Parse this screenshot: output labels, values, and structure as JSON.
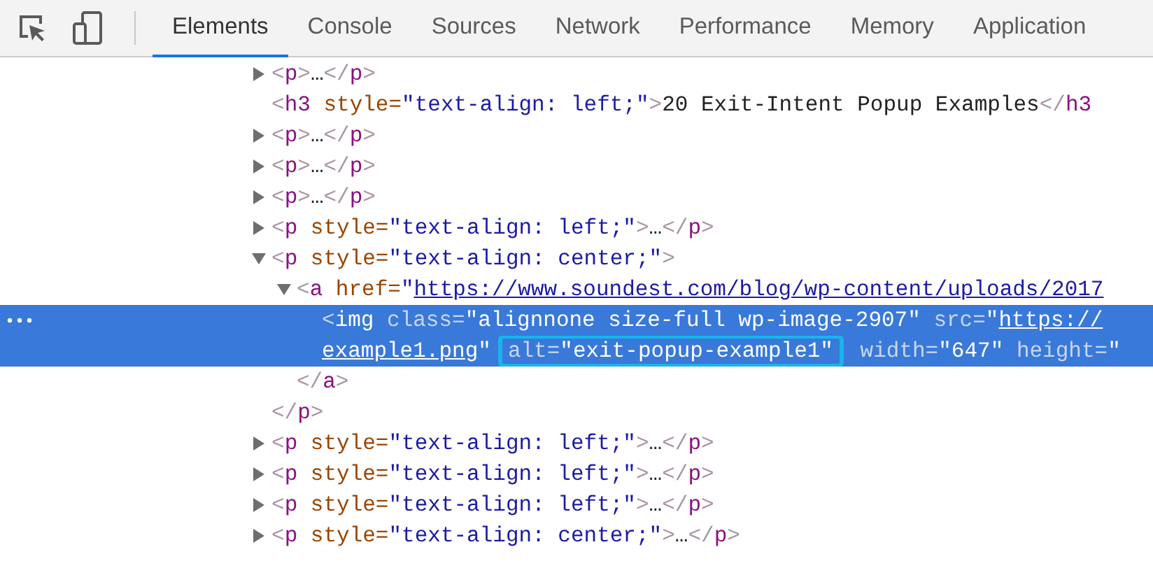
{
  "toolbar": {
    "tabs": [
      {
        "label": "Elements",
        "selected": true
      },
      {
        "label": "Console",
        "selected": false
      },
      {
        "label": "Sources",
        "selected": false
      },
      {
        "label": "Network",
        "selected": false
      },
      {
        "label": "Performance",
        "selected": false
      },
      {
        "label": "Memory",
        "selected": false
      },
      {
        "label": "Application",
        "selected": false
      }
    ]
  },
  "dom_tree": [
    {
      "expanded": false,
      "selected": false,
      "tokens": [
        {
          "kind": "punct",
          "text": "<"
        },
        {
          "kind": "tag",
          "text": "p"
        },
        {
          "kind": "punct",
          "text": ">"
        },
        {
          "kind": "text",
          "text": "…"
        },
        {
          "kind": "punct",
          "text": "</"
        },
        {
          "kind": "tag",
          "text": "p"
        },
        {
          "kind": "punct",
          "text": ">"
        }
      ]
    },
    {
      "selected": false,
      "tokens": [
        {
          "kind": "punct",
          "text": "<"
        },
        {
          "kind": "tag",
          "text": "h3"
        },
        {
          "kind": "attr",
          "text": " style="
        },
        {
          "kind": "value",
          "text": "\"text-align: left;\""
        },
        {
          "kind": "punct",
          "text": ">"
        },
        {
          "kind": "text",
          "text": "20 Exit-Intent Popup Examples"
        },
        {
          "kind": "punct",
          "text": "</"
        },
        {
          "kind": "tag",
          "text": "h3"
        }
      ]
    },
    {
      "expanded": false,
      "selected": false,
      "tokens": [
        {
          "kind": "punct",
          "text": "<"
        },
        {
          "kind": "tag",
          "text": "p"
        },
        {
          "kind": "punct",
          "text": ">"
        },
        {
          "kind": "text",
          "text": "…"
        },
        {
          "kind": "punct",
          "text": "</"
        },
        {
          "kind": "tag",
          "text": "p"
        },
        {
          "kind": "punct",
          "text": ">"
        }
      ]
    },
    {
      "expanded": false,
      "selected": false,
      "tokens": [
        {
          "kind": "punct",
          "text": "<"
        },
        {
          "kind": "tag",
          "text": "p"
        },
        {
          "kind": "punct",
          "text": ">"
        },
        {
          "kind": "text",
          "text": "…"
        },
        {
          "kind": "punct",
          "text": "</"
        },
        {
          "kind": "tag",
          "text": "p"
        },
        {
          "kind": "punct",
          "text": ">"
        }
      ]
    },
    {
      "expanded": false,
      "selected": false,
      "tokens": [
        {
          "kind": "punct",
          "text": "<"
        },
        {
          "kind": "tag",
          "text": "p"
        },
        {
          "kind": "punct",
          "text": ">"
        },
        {
          "kind": "text",
          "text": "…"
        },
        {
          "kind": "punct",
          "text": "</"
        },
        {
          "kind": "tag",
          "text": "p"
        },
        {
          "kind": "punct",
          "text": ">"
        }
      ]
    },
    {
      "expanded": false,
      "selected": false,
      "tokens": [
        {
          "kind": "punct",
          "text": "<"
        },
        {
          "kind": "tag",
          "text": "p"
        },
        {
          "kind": "attr",
          "text": " style="
        },
        {
          "kind": "value",
          "text": "\"text-align: left;\""
        },
        {
          "kind": "punct",
          "text": ">"
        },
        {
          "kind": "text",
          "text": "…"
        },
        {
          "kind": "punct",
          "text": "</"
        },
        {
          "kind": "tag",
          "text": "p"
        },
        {
          "kind": "punct",
          "text": ">"
        }
      ]
    },
    {
      "expanded": true,
      "selected": false,
      "tokens": [
        {
          "kind": "punct",
          "text": "<"
        },
        {
          "kind": "tag",
          "text": "p"
        },
        {
          "kind": "attr",
          "text": " style="
        },
        {
          "kind": "value",
          "text": "\"text-align: center;\""
        },
        {
          "kind": "punct",
          "text": ">"
        }
      ],
      "closing": [
        {
          "kind": "punct",
          "text": "</"
        },
        {
          "kind": "tag",
          "text": "p"
        },
        {
          "kind": "punct",
          "text": ">"
        }
      ],
      "children": [
        {
          "expanded": true,
          "selected": false,
          "tokens": [
            {
              "kind": "punct",
              "text": "<"
            },
            {
              "kind": "tag",
              "text": "a"
            },
            {
              "kind": "attr",
              "text": " href="
            },
            {
              "kind": "value",
              "text": "\""
            },
            {
              "kind": "link",
              "text": "https://www.soundest.com/blog/wp-content/uploads/2017"
            }
          ],
          "closing": [
            {
              "kind": "punct",
              "text": "</"
            },
            {
              "kind": "tag",
              "text": "a"
            },
            {
              "kind": "punct",
              "text": ">"
            }
          ],
          "children": [
            {
              "selected": true,
              "tokens": [
                {
                  "kind": "punct",
                  "text": "<"
                },
                {
                  "kind": "tag",
                  "text": "img"
                },
                {
                  "kind": "attr",
                  "text": " class="
                },
                {
                  "kind": "value",
                  "text": "\"alignnone size-full wp-image-2907\""
                },
                {
                  "kind": "attr",
                  "text": " src="
                },
                {
                  "kind": "value",
                  "text": "\""
                },
                {
                  "kind": "link",
                  "text": "https://"
                }
              ],
              "continuation": [
                {
                  "kind": "link",
                  "text": "example1.png"
                },
                {
                  "kind": "value",
                  "text": "\""
                },
                {
                  "kind": "group",
                  "tokens": [
                    {
                      "kind": "attr",
                      "text": "alt="
                    },
                    {
                      "kind": "value",
                      "text": "\"exit-popup-example1\""
                    }
                  ]
                },
                {
                  "kind": "attr",
                  "text": " width="
                },
                {
                  "kind": "value",
                  "text": "\"647\""
                },
                {
                  "kind": "attr",
                  "text": " height="
                },
                {
                  "kind": "value",
                  "text": "\""
                }
              ]
            }
          ]
        }
      ]
    },
    {
      "expanded": false,
      "selected": false,
      "tokens": [
        {
          "kind": "punct",
          "text": "<"
        },
        {
          "kind": "tag",
          "text": "p"
        },
        {
          "kind": "attr",
          "text": " style="
        },
        {
          "kind": "value",
          "text": "\"text-align: left;\""
        },
        {
          "kind": "punct",
          "text": ">"
        },
        {
          "kind": "text",
          "text": "…"
        },
        {
          "kind": "punct",
          "text": "</"
        },
        {
          "kind": "tag",
          "text": "p"
        },
        {
          "kind": "punct",
          "text": ">"
        }
      ]
    },
    {
      "expanded": false,
      "selected": false,
      "tokens": [
        {
          "kind": "punct",
          "text": "<"
        },
        {
          "kind": "tag",
          "text": "p"
        },
        {
          "kind": "attr",
          "text": " style="
        },
        {
          "kind": "value",
          "text": "\"text-align: left;\""
        },
        {
          "kind": "punct",
          "text": ">"
        },
        {
          "kind": "text",
          "text": "…"
        },
        {
          "kind": "punct",
          "text": "</"
        },
        {
          "kind": "tag",
          "text": "p"
        },
        {
          "kind": "punct",
          "text": ">"
        }
      ]
    },
    {
      "expanded": false,
      "selected": false,
      "tokens": [
        {
          "kind": "punct",
          "text": "<"
        },
        {
          "kind": "tag",
          "text": "p"
        },
        {
          "kind": "attr",
          "text": " style="
        },
        {
          "kind": "value",
          "text": "\"text-align: left;\""
        },
        {
          "kind": "punct",
          "text": ">"
        },
        {
          "kind": "text",
          "text": "…"
        },
        {
          "kind": "punct",
          "text": "</"
        },
        {
          "kind": "tag",
          "text": "p"
        },
        {
          "kind": "punct",
          "text": ">"
        }
      ]
    },
    {
      "expanded": false,
      "selected": false,
      "tokens": [
        {
          "kind": "punct",
          "text": "<"
        },
        {
          "kind": "tag",
          "text": "p"
        },
        {
          "kind": "attr",
          "text": " style="
        },
        {
          "kind": "value",
          "text": "\"text-align: center;\""
        },
        {
          "kind": "punct",
          "text": ">"
        },
        {
          "kind": "text",
          "text": "…"
        },
        {
          "kind": "punct",
          "text": "</"
        },
        {
          "kind": "tag",
          "text": "p"
        },
        {
          "kind": "punct",
          "text": ">"
        }
      ]
    }
  ]
}
